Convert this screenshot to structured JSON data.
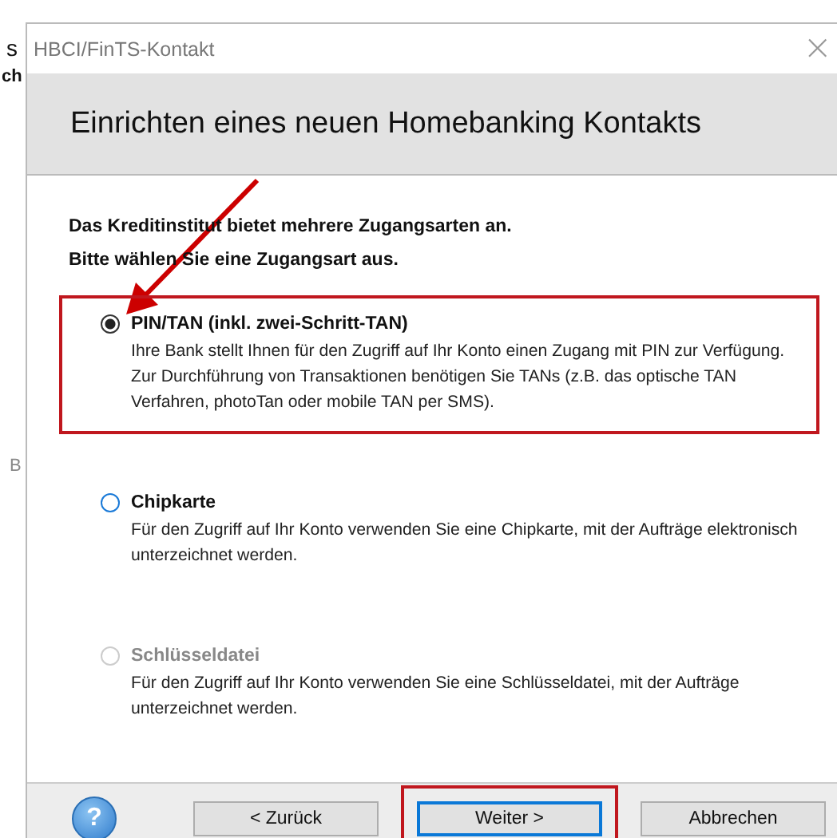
{
  "background_fragments": [
    {
      "text": "s"
    },
    {
      "text": "ch"
    },
    {
      "text": "B"
    }
  ],
  "window": {
    "title": "HBCI/FinTS-Kontakt",
    "close": "×"
  },
  "header": {
    "title": "Einrichten eines neuen Homebanking Kontakts"
  },
  "intro": [
    "Das Kreditinstitut bietet mehrere Zugangsarten an.",
    "Bitte wählen Sie eine Zugangsart aus."
  ],
  "options": [
    {
      "label": "PIN/TAN (inkl. zwei-Schritt-TAN)",
      "description": "Ihre Bank stellt Ihnen für den Zugriff auf Ihr Konto einen Zugang mit PIN zur Verfügung. Zur Durchführung von Transaktionen benötigen Sie TANs (z.B. das optische TAN Verfahren, photoTan oder mobile TAN per SMS).",
      "selected": true,
      "disabled": false,
      "highlighted": true
    },
    {
      "label": "Chipkarte",
      "description": "Für den Zugriff auf Ihr Konto verwenden Sie eine Chipkarte, mit der Aufträge elektronisch unterzeichnet werden.",
      "selected": false,
      "disabled": false,
      "highlighted": false
    },
    {
      "label": "Schlüsseldatei",
      "description": "Für den Zugriff auf Ihr Konto verwenden Sie eine Schlüsseldatei, mit der Aufträge unterzeichnet werden.",
      "selected": false,
      "disabled": true,
      "highlighted": false
    }
  ],
  "footer": {
    "help": "?",
    "buttons": [
      {
        "label": "< Zurück",
        "default": false,
        "highlighted": false
      },
      {
        "label": "Weiter >",
        "default": true,
        "highlighted": true
      },
      {
        "label": "Abbrechen",
        "default": false,
        "highlighted": false
      }
    ]
  }
}
